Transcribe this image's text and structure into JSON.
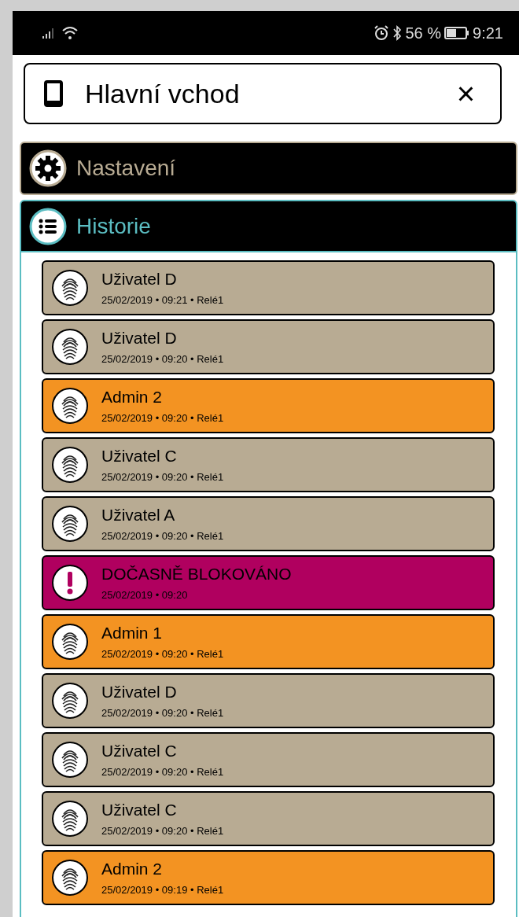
{
  "status_bar": {
    "battery": "56 %",
    "time": "9:21"
  },
  "device": {
    "title": "Hlavní vchod",
    "close": "×"
  },
  "sections": [
    {
      "kind": "settings",
      "label": "Nastavení",
      "expanded": false
    },
    {
      "kind": "history",
      "label": "Historie",
      "expanded": true
    }
  ],
  "history": [
    {
      "kind": "user",
      "title": "Uživatel D",
      "detail": "25/02/2019 • 09:21 • Relé1"
    },
    {
      "kind": "user",
      "title": "Uživatel D",
      "detail": "25/02/2019 • 09:20 • Relé1"
    },
    {
      "kind": "admin",
      "title": "Admin 2",
      "detail": "25/02/2019 • 09:20 • Relé1"
    },
    {
      "kind": "user",
      "title": "Uživatel C",
      "detail": "25/02/2019 • 09:20 • Relé1"
    },
    {
      "kind": "user",
      "title": "Uživatel A",
      "detail": "25/02/2019 • 09:20 • Relé1"
    },
    {
      "kind": "alert",
      "title": "DOČASNĚ BLOKOVÁNO",
      "detail": "25/02/2019 • 09:20"
    },
    {
      "kind": "admin",
      "title": "Admin 1",
      "detail": "25/02/2019 • 09:20 • Relé1"
    },
    {
      "kind": "user",
      "title": "Uživatel D",
      "detail": "25/02/2019 • 09:20 • Relé1"
    },
    {
      "kind": "user",
      "title": "Uživatel C",
      "detail": "25/02/2019 • 09:20 • Relé1"
    },
    {
      "kind": "user",
      "title": "Uživatel C",
      "detail": "25/02/2019 • 09:20 • Relé1"
    },
    {
      "kind": "admin",
      "title": "Admin 2",
      "detail": "25/02/2019 • 09:19 • Relé1"
    }
  ]
}
